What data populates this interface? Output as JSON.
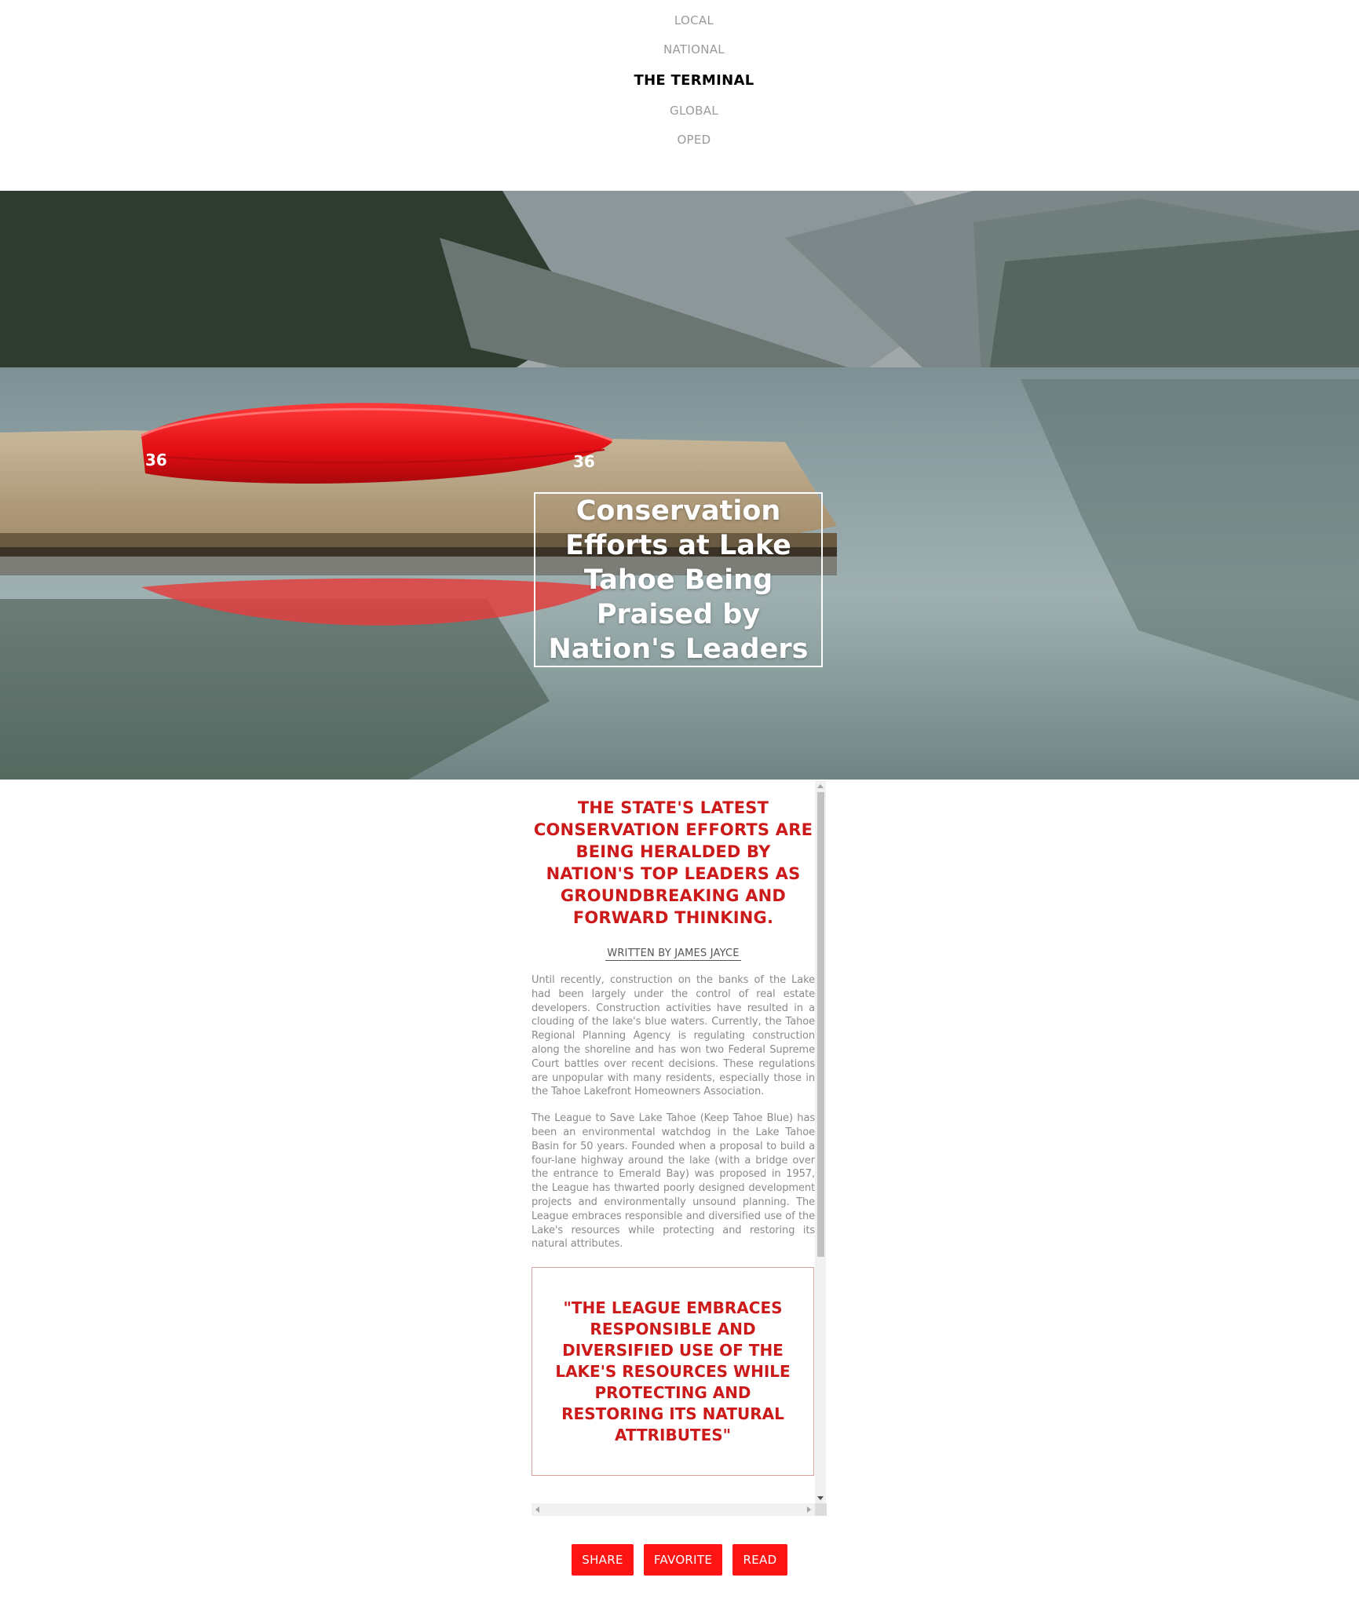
{
  "nav": {
    "items": [
      "LOCAL",
      "NATIONAL",
      "THE TERMINAL",
      "GLOBAL",
      "OPED"
    ],
    "active": "THE TERMINAL"
  },
  "hero": {
    "title": "Conservation Efforts at Lake Tahoe Being Praised by Nation's Leaders",
    "canoe_number": "36"
  },
  "article": {
    "headline": "THE STATE'S LATEST CONSERVATION EFFORTS ARE BEING HERALDED BY NATION'S TOP LEADERS AS GROUNDBREAKING AND FORWARD THINKING.",
    "byline": "WRITTEN BY JAMES JAYCE",
    "paragraphs": [
      "Until recently, construction on the banks of the Lake had been largely under the control of real estate developers. Construction activities have resulted in a clouding of the lake's blue waters. Currently, the Tahoe Regional Planning Agency is regulating construction along the shoreline and has won two Federal Supreme Court battles over recent decisions. These regulations are unpopular with many residents, especially those in the Tahoe Lakefront Homeowners Association.",
      "The League to Save Lake Tahoe (Keep Tahoe Blue) has been an environmental watchdog in the Lake Tahoe Basin for 50 years. Founded when a proposal to build a four-lane highway around the lake (with a bridge over the entrance to Emerald Bay) was proposed in 1957, the League has thwarted poorly designed development projects and environmentally unsound planning. The League embraces responsible and diversified use of the Lake's resources while protecting and restoring its natural attributes."
    ],
    "pullquote": "\"THE LEAGUE EMBRACES RESPONSIBLE AND DIVERSIFIED USE OF THE LAKE'S RESOURCES WHILE PROTECTING AND RESTORING ITS NATURAL ATTRIBUTES\""
  },
  "actions": {
    "share": "SHARE",
    "favorite": "FAVORITE",
    "read": "READ"
  },
  "colors": {
    "accent_red": "#ff1414",
    "headline_red": "#cc1a1a",
    "body_gray": "#8a8a8a"
  }
}
